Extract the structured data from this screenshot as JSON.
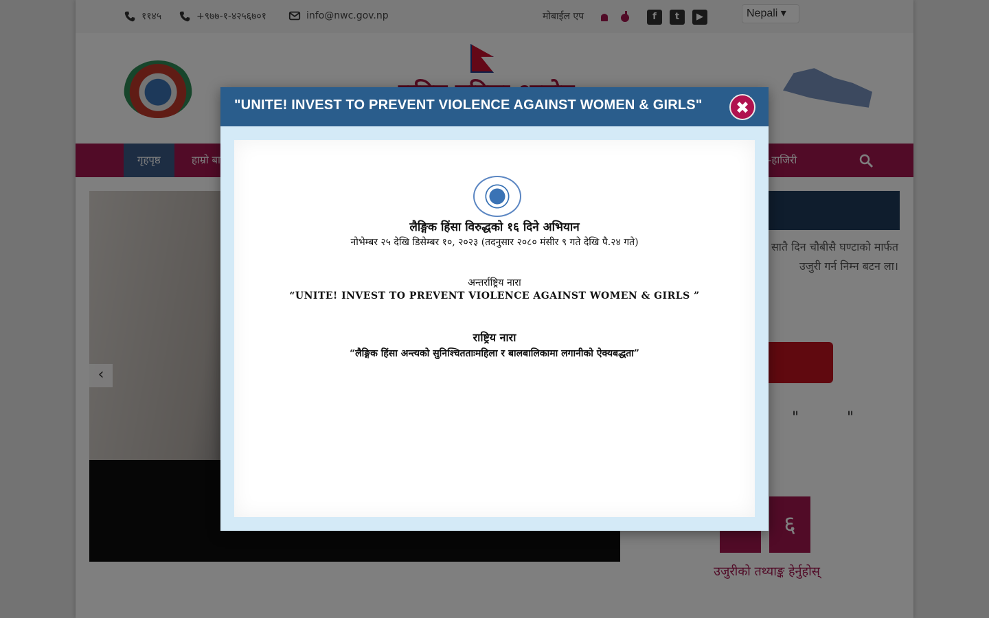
{
  "topbar": {
    "hotline": "११४५",
    "phone": "+९७७-१-४२५६७०१",
    "email": "info@nwc.gov.np",
    "mobile_app_label": "मोबाईल एप",
    "language": "Nepali"
  },
  "header": {
    "site_title": "राष्ट्रिय महिला आयोग"
  },
  "nav": {
    "items": [
      {
        "label": "गृहपृष्ठ"
      },
      {
        "label": "हाम्रो बा"
      },
      {
        "label": "-हाजिरी"
      }
    ]
  },
  "side": {
    "text": "दर्ता गर्नुहोस्। राष्ट्रिय महिला सातै दिन चौबीसै घण्टाको मार्फत उजुरी गर्न निम्न बटन ला।",
    "quote_marks": "\"          \"",
    "counter_digit": "६",
    "stats_link": "उजुरीको तथ्याङ्क हेर्नुहोस्"
  },
  "modal": {
    "title": "\"UNITE! INVEST TO PREVENT VIOLENCE AGAINST WOMEN & GIRLS\"",
    "close_symbol": "✖",
    "notice": {
      "title": "लैङ्गिक हिंसा विरुद्धको १६ दिने अभियान",
      "dates": "नोभेम्बर २५ देखि डिसेम्बर १०, २०२३ (तदनुसार २०८० मंसीर ९ गते देखि पै.२४ गते)",
      "intl_heading": "अन्तर्राष्ट्रिय नारा",
      "intl_slogan": "“UNITE!  INVEST  TO  PREVENT  VIOLENCE  AGAINST  WOMEN & GIRLS ”",
      "national_heading": "राष्ट्रिय नारा",
      "national_slogan": "“लैङ्गिक हिंसा अन्त्यको सुनिश्चितताःमहिला र बालबालिकामा लगानीको ऐक्यबद्धता”"
    }
  }
}
